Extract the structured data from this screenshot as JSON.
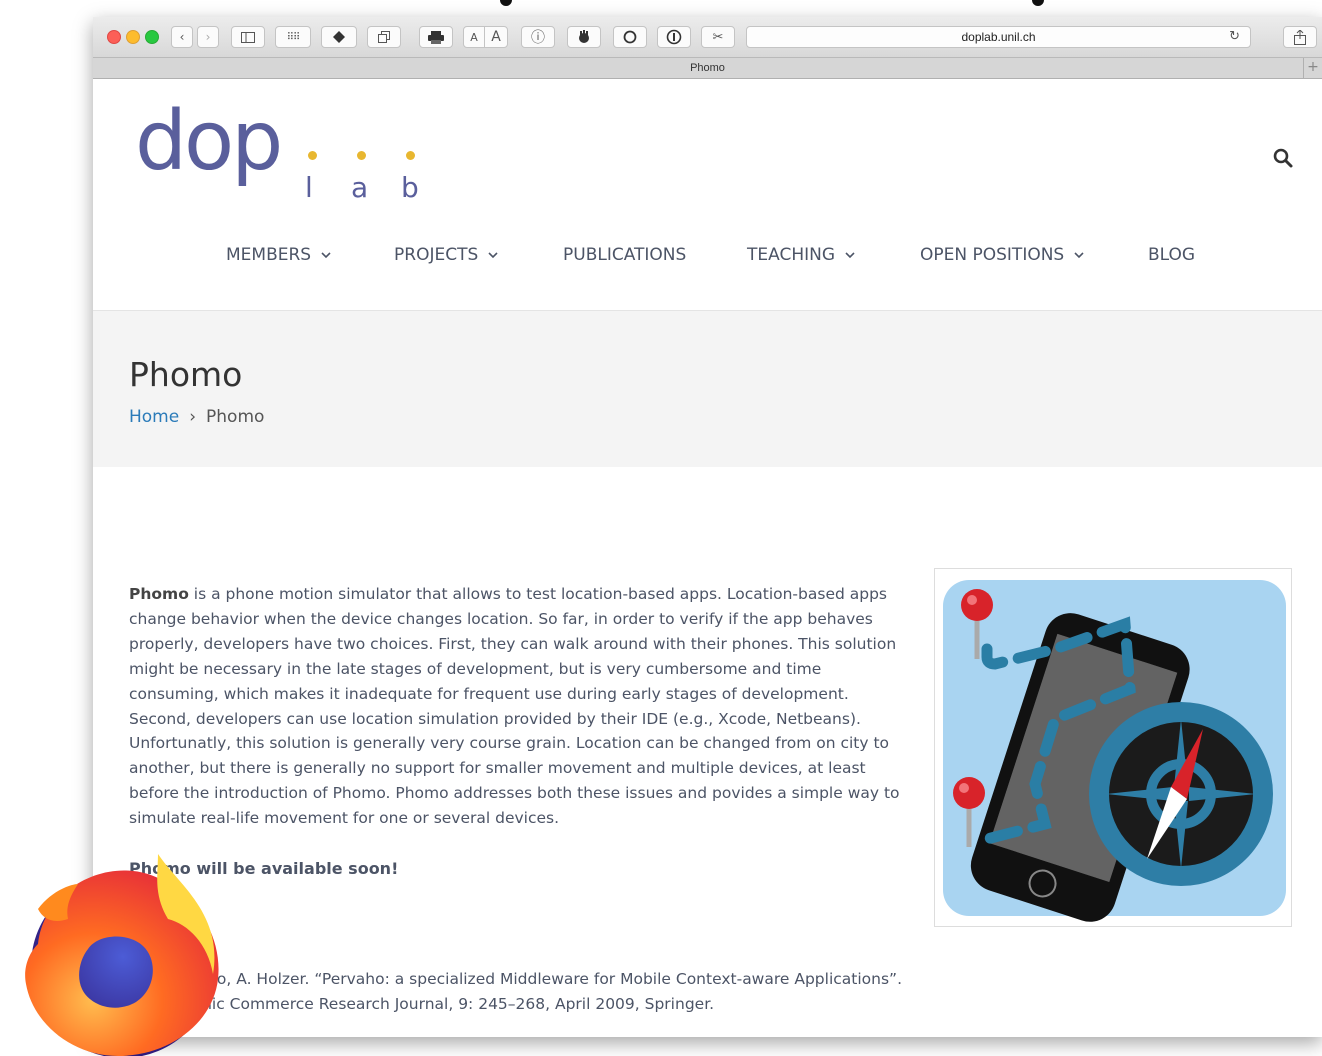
{
  "browser": {
    "url": "doplab.unil.ch",
    "tab_title": "Phomo",
    "text_size_small": "A",
    "text_size_large": "A"
  },
  "site": {
    "logo_main": "dop",
    "logo_sub": [
      "l",
      "a",
      "b"
    ],
    "nav": [
      {
        "label": "MEMBERS",
        "dropdown": true
      },
      {
        "label": "PROJECTS",
        "dropdown": true
      },
      {
        "label": "PUBLICATIONS",
        "dropdown": false
      },
      {
        "label": "TEACHING",
        "dropdown": true
      },
      {
        "label": "OPEN POSITIONS",
        "dropdown": true
      },
      {
        "label": "BLOG",
        "dropdown": false
      }
    ]
  },
  "page": {
    "title": "Phomo",
    "breadcrumb_home": "Home",
    "breadcrumb_sep": "›",
    "breadcrumb_current": "Phomo",
    "intro_bold": "Phomo",
    "intro_rest": " is a phone motion simulator that allows to test location-based apps. Location-based apps change behavior when the device changes location. So far, in order to verify if the app behaves properly, developers have two choices. First, they can walk around with their phones. This solution might be necessary in the late stages of development, but is very cumbersome and time consuming, which makes it inadequate for frequent use during early stages of development. Second, developers can use location simulation provided by their IDE (e.g., Xcode, Netbeans). Unfortunatly, this solution is generally very course grain. Location can be changed from on city to another, but there is generally no support for smaller movement and multiple devices, at least before the introduction of Phomo. Phomo addresses both these issues and povides a simple way to simulate real-life movement for one or several devices.",
    "availability": "Phomo will be available soon!",
    "reference": "B. Garbinato, A. Holzer. “Pervaho: a specialized Middleware for Mobile Context-aware Applications”. In Electronic Commerce Research Journal, 9: 245–268, April 2009, Springer."
  },
  "colors": {
    "logo": "#5a5f9c",
    "logo_dots": "#e8b730",
    "link": "#2b7bb9",
    "nav_text": "#4c5466"
  }
}
